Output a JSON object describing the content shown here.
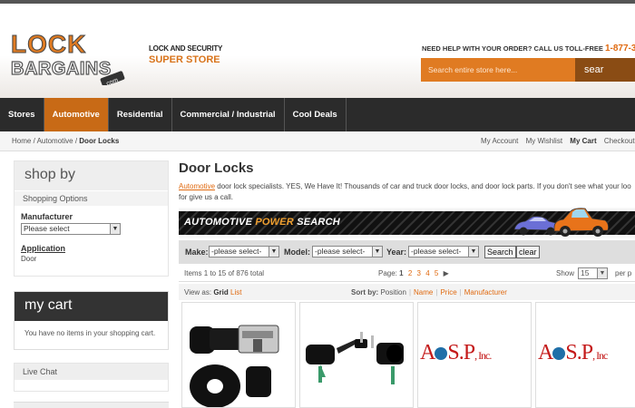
{
  "logo": {
    "line1": "LOCK",
    "line2": "BARGAINS",
    "suffix": ".com"
  },
  "tagline": {
    "line1": "LOCK AND SECURITY",
    "line2": "SUPER STORE"
  },
  "help": {
    "text": "NEED HELP WITH YOUR ORDER? CALL US TOLL-FREE",
    "phone": "1-877-341-"
  },
  "search": {
    "placeholder": "Search entire store here...",
    "button": "sear"
  },
  "nav": {
    "items": [
      "Stores",
      "Automotive",
      "Residential",
      "Commercial / Industrial",
      "Cool Deals"
    ],
    "active": "Automotive"
  },
  "breadcrumb": {
    "home": "Home",
    "sep": " / ",
    "automotive": "Automotive",
    "current": "Door Locks"
  },
  "toplinks": {
    "account": "My Account",
    "wishlist": "My Wishlist",
    "cart": "My Cart",
    "checkout": "Checkout",
    "extra": "L"
  },
  "shopby": {
    "title": "shop by",
    "subtitle": "Shopping Options",
    "manufacturer_label": "Manufacturer",
    "manufacturer_value": "Please select",
    "application_label": "Application",
    "application_value": "Door"
  },
  "cart": {
    "title": "my cart",
    "empty": "You have no items in your shopping cart."
  },
  "livechat": {
    "title": "Live Chat"
  },
  "main": {
    "title": "Door Locks",
    "intro_link": "Automotive",
    "intro_text": " door lock specialists. YES, We Have It! Thousands of car and truck door locks, and door lock parts. If you don't see what your loo",
    "intro_text2": "for give us a call."
  },
  "banner": {
    "text1": "AUTOMOTIVE ",
    "text2": "POWER",
    "text3": " SEARCH"
  },
  "powersearch": {
    "make_label": "Make:",
    "make_value": "-please select-",
    "model_label": "Model:",
    "model_value": "-please select-",
    "year_label": "Year:",
    "year_value": "-please select-",
    "search_button": "Search",
    "clear_button": "clear"
  },
  "toolbar": {
    "count": "Items 1 to 15 of 876 total",
    "page_label": "Page:",
    "current_page": "1",
    "pages": [
      "2",
      "3",
      "4",
      "5"
    ],
    "next": "▶",
    "show_label": "Show",
    "show_value": "15",
    "per_page": "per p",
    "view_as_label": "View as:",
    "view_grid": "Grid",
    "view_list": "List",
    "sort_label": "Sort by:",
    "sort_current": "Position",
    "sort_name": "Name",
    "sort_price": "Price",
    "sort_manufacturer": "Manufacturer"
  },
  "products": [
    {
      "brand": ""
    },
    {
      "brand": ""
    },
    {
      "brand_a": "A",
      "brand_b": "S",
      "brand_c": "P",
      "brand_inc": ", Inc."
    },
    {
      "brand_a": "A",
      "brand_b": "S",
      "brand_c": "P",
      "brand_inc": ", Inc"
    }
  ],
  "colors": {
    "accent": "#c86a16",
    "nav_bg": "#2b2b2b",
    "link": "#e06a10",
    "logo_orange": "#e07b22"
  }
}
